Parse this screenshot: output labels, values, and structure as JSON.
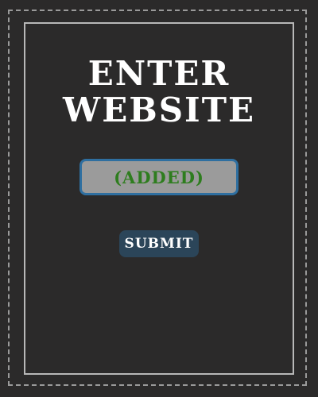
{
  "title": {
    "line1": "ENTER",
    "line2": "WEBSITE"
  },
  "field": {
    "value": "(ADDED)"
  },
  "submit": {
    "label": "SUBMIT"
  },
  "colors": {
    "background": "#2b2a2a",
    "title": "#ffffff",
    "field_bg": "#9b9b9b",
    "field_border": "#2f6fa0",
    "field_text": "#2e7d1e",
    "button_bg": "#2b4559",
    "button_text": "#ffffff"
  }
}
